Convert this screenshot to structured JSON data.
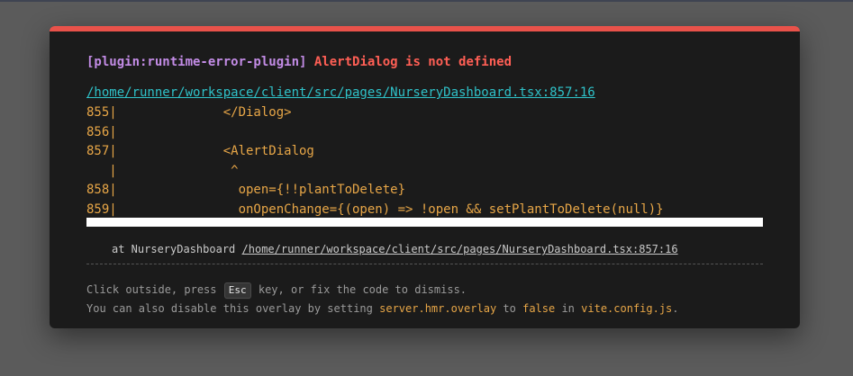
{
  "error": {
    "plugin_tag": "[plugin:runtime-error-plugin]",
    "message": "AlertDialog is not defined",
    "file_link": "/home/runner/workspace/client/src/pages/NurseryDashboard.tsx:857:16"
  },
  "code_frame": [
    "855|              </Dialog>",
    "856|",
    "857|              <AlertDialog",
    "   |               ^",
    "858|                open={!!plantToDelete}",
    "859|                onOpenChange={(open) => !open && setPlantToDelete(null)}"
  ],
  "stack": {
    "prefix": "at NurseryDashboard",
    "link": "/home/runner/workspace/client/src/pages/NurseryDashboard.tsx:857:16"
  },
  "tip": {
    "line1_a": "Click outside, press",
    "key": "Esc",
    "line1_b": "key, or fix the code to dismiss.",
    "line2_a": "You can also disable this overlay by setting",
    "line2_setting": "server.hmr.overlay",
    "line2_b": "to",
    "line2_value": "false",
    "line2_c": "in",
    "line2_file": "vite.config.js",
    "line2_end": "."
  },
  "colors": {
    "accent_red": "#e9524a",
    "plugin_purple": "#c38ce6",
    "link_cyan": "#2fc2c9",
    "code_yellow": "#e7a647"
  }
}
